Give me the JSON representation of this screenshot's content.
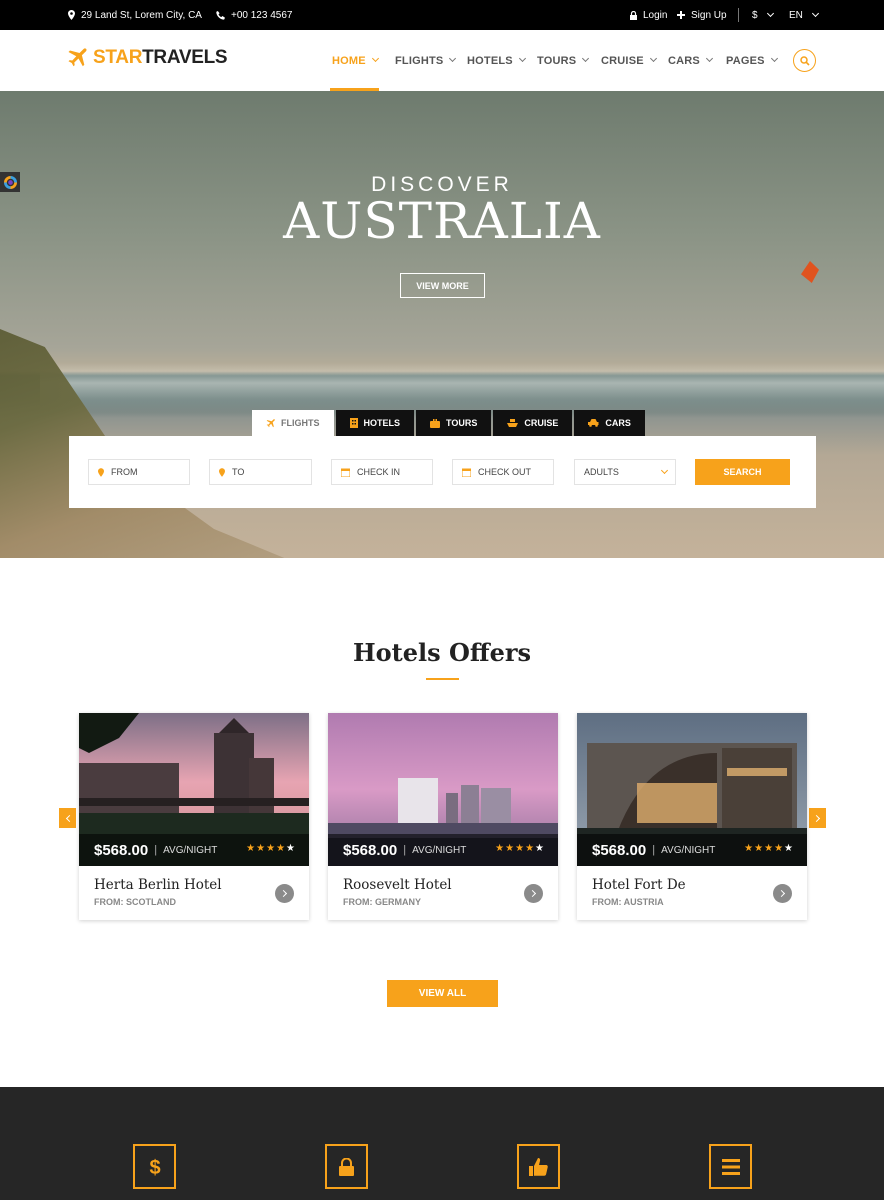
{
  "topbar": {
    "address": "29 Land St, Lorem City, CA",
    "phone": "+00 123 4567",
    "login": "Login",
    "signup": "Sign Up",
    "currency": "$",
    "language": "EN"
  },
  "brand": {
    "part1": "STAR",
    "part2": "TRAVELS"
  },
  "nav": [
    {
      "label": "HOME",
      "active": true
    },
    {
      "label": "FLIGHTS"
    },
    {
      "label": "HOTELS"
    },
    {
      "label": "TOURS"
    },
    {
      "label": "CRUISE"
    },
    {
      "label": "CARS"
    },
    {
      "label": "PAGES"
    }
  ],
  "hero": {
    "subtitle": "DISCOVER",
    "title": "AUSTRALIA",
    "button": "VIEW MORE"
  },
  "search": {
    "tabs": [
      "FLIGHTS",
      "HOTELS",
      "TOURS",
      "CRUISE",
      "CARS"
    ],
    "active_tab": "FLIGHTS",
    "from_placeholder": "FROM",
    "to_placeholder": "TO",
    "checkin_placeholder": "CHECK IN",
    "checkout_placeholder": "CHECK OUT",
    "adults": "ADULTS",
    "submit": "SEARCH"
  },
  "hotels": {
    "title": "Hotels Offers",
    "per_label": "AVG/NIGHT",
    "items": [
      {
        "price": "$568.00",
        "name": "Herta Berlin Hotel",
        "from": "FROM: SCOTLAND",
        "stars": 4
      },
      {
        "price": "$568.00",
        "name": "Roosevelt Hotel",
        "from": "FROM: GERMANY",
        "stars": 4
      },
      {
        "price": "$568.00",
        "name": "Hotel Fort De",
        "from": "FROM: AUSTRIA",
        "stars": 4
      }
    ],
    "view_all": "VIEW ALL"
  },
  "features": {
    "icons": [
      "dollar-icon",
      "lock-icon",
      "thumbs-up-icon",
      "menu-icon"
    ]
  },
  "colors": {
    "accent": "#f7a21b",
    "dark": "#262626",
    "topbar": "#000000"
  }
}
